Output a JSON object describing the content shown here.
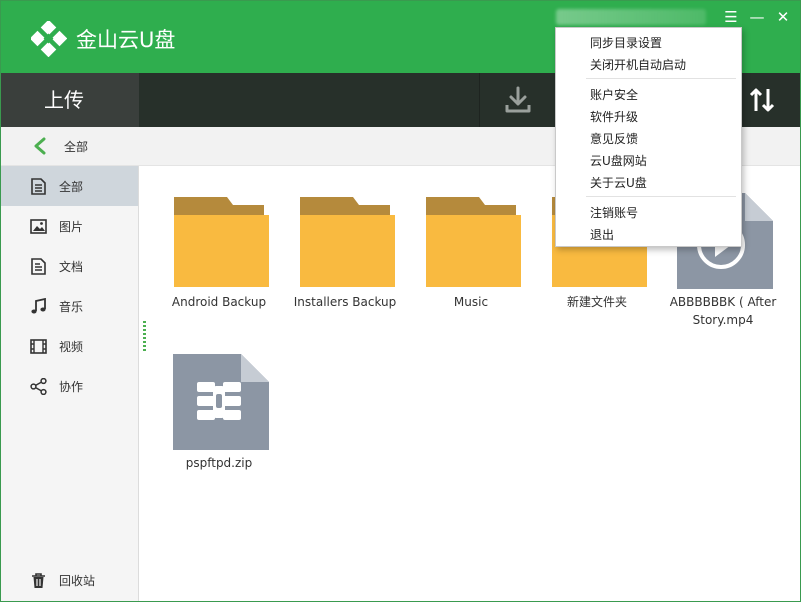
{
  "app": {
    "title": "金山云U盘"
  },
  "window_controls": {
    "menu": "☰",
    "minimize": "—",
    "close": "✕"
  },
  "toolbar": {
    "upload_label": "上传"
  },
  "breadcrumb": {
    "current": "全部"
  },
  "sidebar": {
    "items": [
      {
        "label": "全部",
        "icon": "document-icon",
        "active": true
      },
      {
        "label": "图片",
        "icon": "image-icon"
      },
      {
        "label": "文档",
        "icon": "text-document-icon"
      },
      {
        "label": "音乐",
        "icon": "music-note-icon"
      },
      {
        "label": "视频",
        "icon": "film-icon"
      },
      {
        "label": "协作",
        "icon": "share-icon"
      }
    ],
    "trash": {
      "label": "回收站",
      "icon": "trash-icon"
    }
  },
  "files": [
    {
      "name": "Android Backup",
      "type": "folder"
    },
    {
      "name": "Installers Backup",
      "type": "folder"
    },
    {
      "name": "Music",
      "type": "folder"
    },
    {
      "name": "新建文件夹",
      "type": "folder"
    },
    {
      "name_line1": "ABBBBBBK ( After",
      "name_line2": "Story.mp4",
      "type": "video"
    },
    {
      "name": "pspftpd.zip",
      "type": "zip"
    }
  ],
  "menu": {
    "items": [
      "同步目录设置",
      "关闭开机自动启动",
      "账户安全",
      "软件升级",
      "意见反馈",
      "云U盘网站",
      "关于云U盘",
      "注销账号",
      "退出"
    ]
  },
  "colors": {
    "titlebar": "#2fae4e",
    "toolbar": "#27302a",
    "folder_body": "#f9ba40",
    "folder_tab": "#b58a3c",
    "file_icon": "#8c96a4",
    "accent": "#4caf50"
  }
}
